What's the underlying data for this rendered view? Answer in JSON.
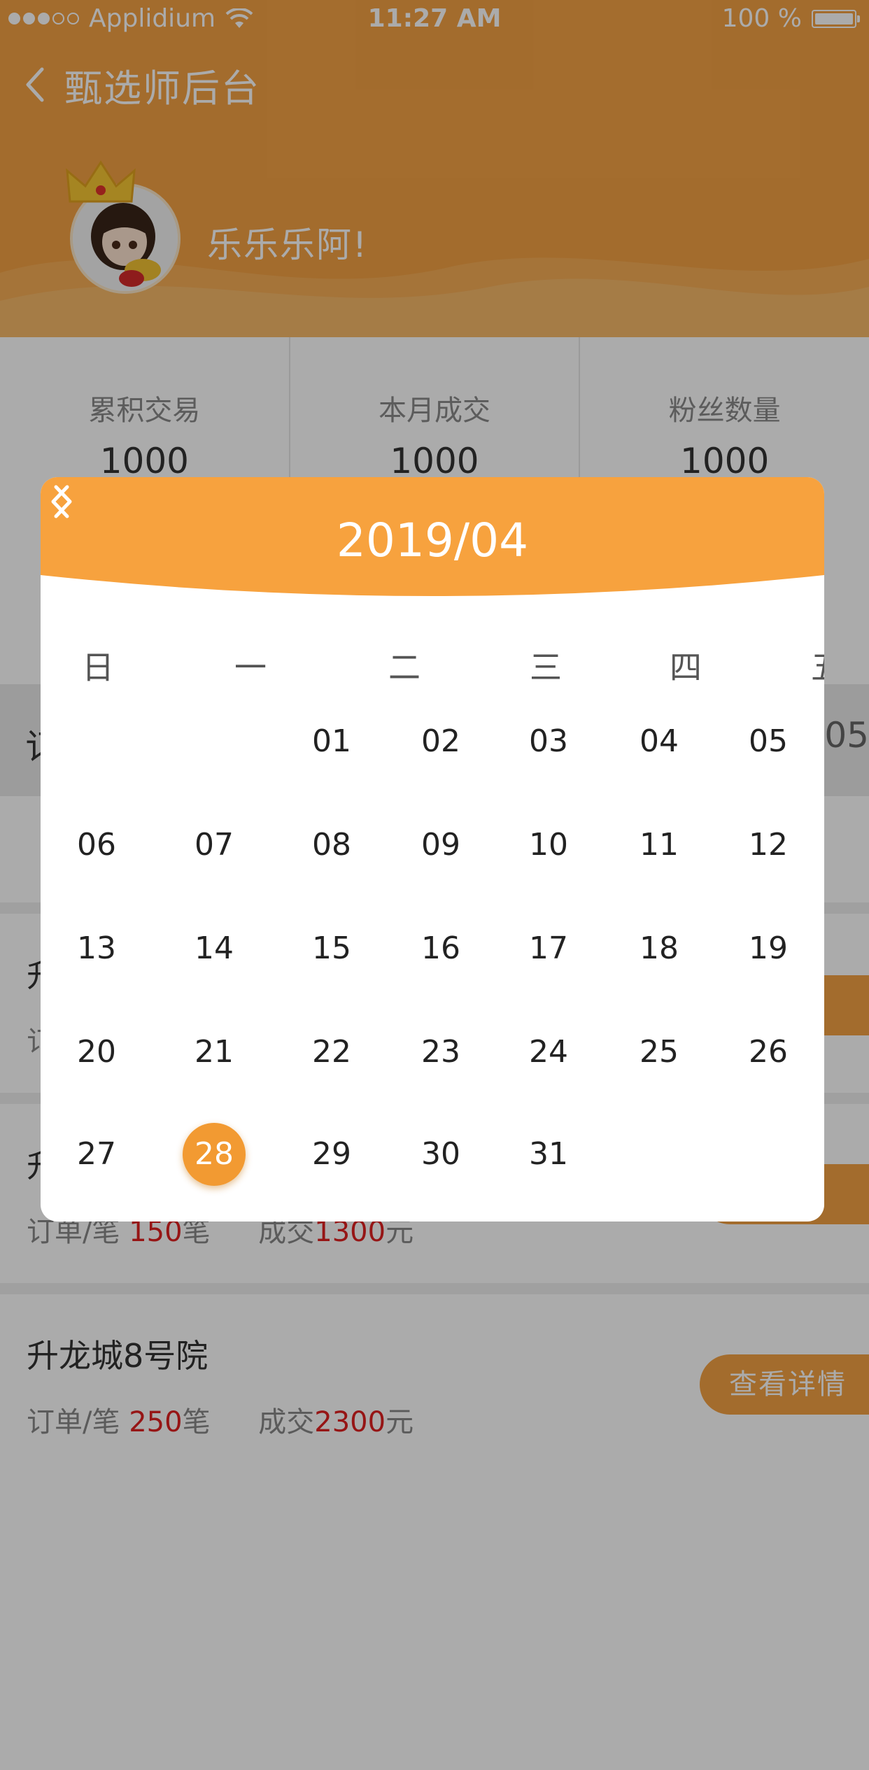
{
  "status_bar": {
    "carrier": "Applidium",
    "time": "11:27 AM",
    "battery": "100 %"
  },
  "nav": {
    "title": "甄选师后台"
  },
  "profile": {
    "name": "乐乐乐阿!"
  },
  "stats": [
    {
      "label": "累积交易",
      "value": "1000"
    },
    {
      "label": "本月成交",
      "value": "1000"
    },
    {
      "label": "粉丝数量",
      "value": "1000"
    }
  ],
  "filter": {
    "label": "订",
    "date": "-05"
  },
  "projects": [
    {
      "name": "升",
      "orders_label": "订",
      "orders_value": "",
      "orders_unit": "",
      "deal_label": "",
      "deal_value": "",
      "deal_unit": "",
      "button": "情"
    },
    {
      "name": "升",
      "orders_label": "订单/笔 ",
      "orders_value": "150",
      "orders_unit": "笔",
      "deal_label": "成交",
      "deal_value": "1300",
      "deal_unit": "元",
      "button": "情"
    },
    {
      "name": "升龙城8号院",
      "orders_label": "订单/笔 ",
      "orders_value": "250",
      "orders_unit": "笔",
      "deal_label": "成交",
      "deal_value": "2300",
      "deal_unit": "元",
      "button": "查看详情"
    }
  ],
  "calendar": {
    "title": "2019/04",
    "weekdays": [
      "日",
      "一",
      "二",
      "三",
      "四",
      "五"
    ],
    "days": [
      "01",
      "02",
      "03",
      "04",
      "05",
      "06",
      "07",
      "08",
      "09",
      "10",
      "11",
      "12",
      "13",
      "14",
      "15",
      "16",
      "17",
      "18",
      "19",
      "20",
      "21",
      "22",
      "23",
      "24",
      "25",
      "26",
      "27",
      "28",
      "29",
      "30",
      "31"
    ],
    "selected": "28"
  },
  "colors": {
    "accent": "#f4a244",
    "header_dark": "#e08a2c",
    "selected": "#f29a32",
    "red": "#e02020"
  }
}
